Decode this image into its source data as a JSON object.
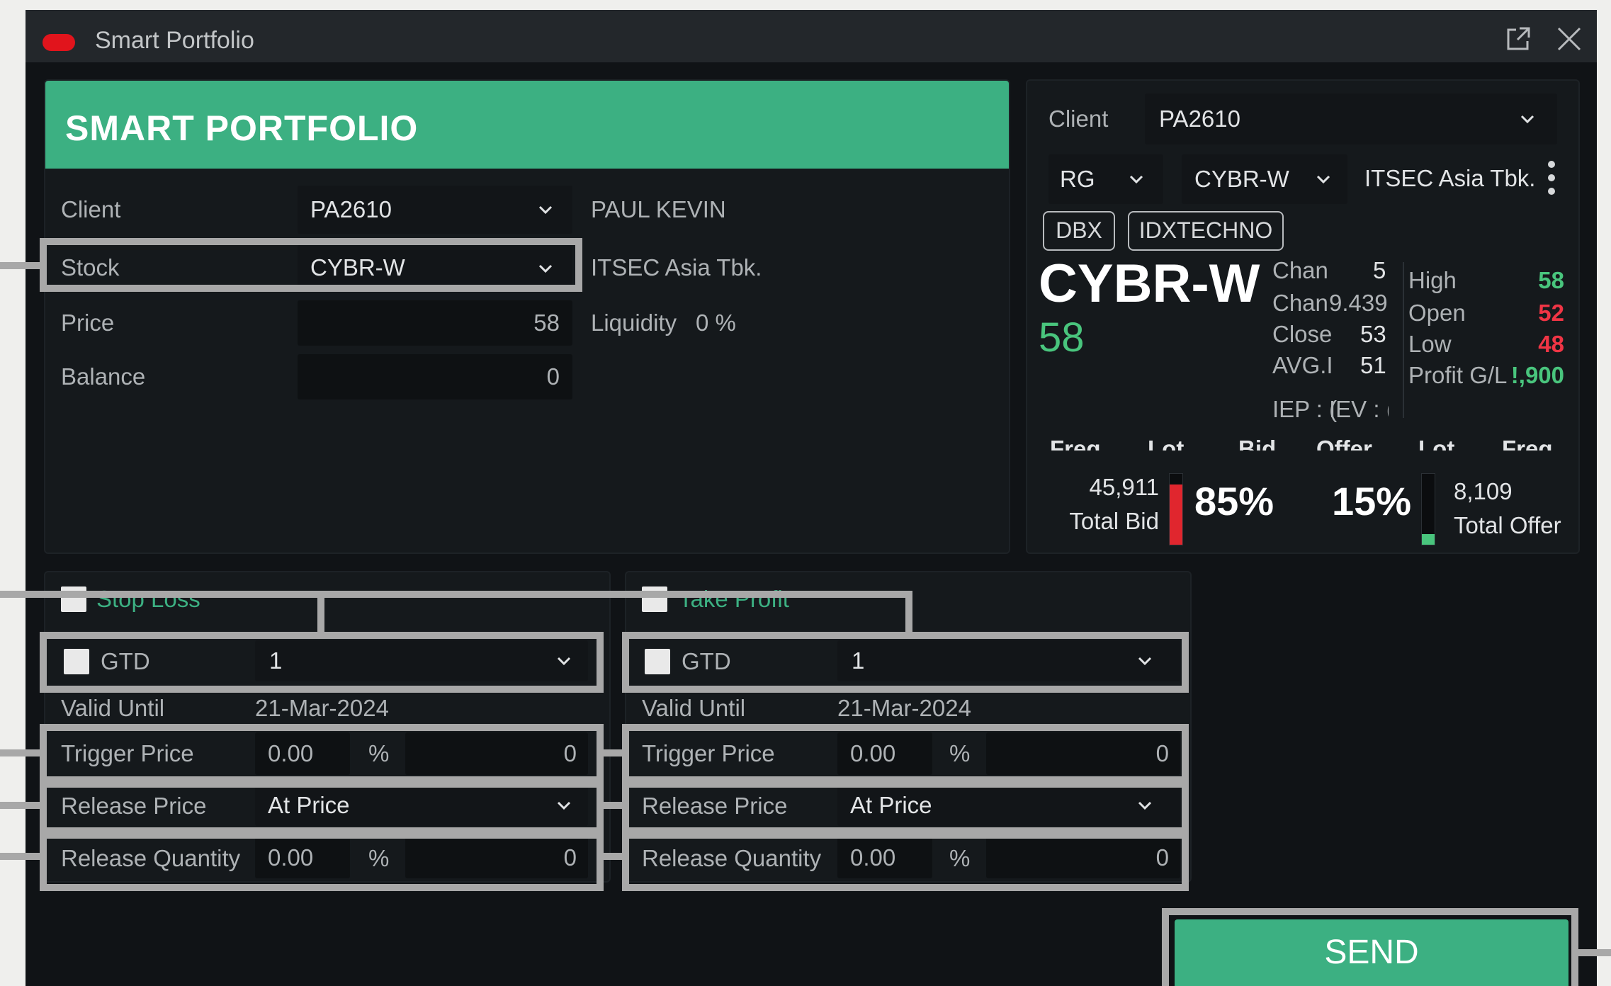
{
  "window": {
    "title": "Smart Portfolio"
  },
  "order": {
    "header": "SMART PORTFOLIO",
    "client_label": "Client",
    "client_value": "PA2610",
    "client_name": "PAUL KEVIN",
    "stock_label": "Stock",
    "stock_value": "CYBR-W",
    "stock_name": "ITSEC Asia Tbk.",
    "price_label": "Price",
    "price_value": "58",
    "liquidity_label": "Liquidity",
    "liquidity_value": "0 %",
    "balance_label": "Balance",
    "balance_value": "0"
  },
  "stop_loss": {
    "title": "Stop Loss",
    "gtd_label": "GTD",
    "gtd_value": "1",
    "valid_until_label": "Valid Until",
    "valid_until_value": "21-Mar-2024",
    "trigger_label": "Trigger Price",
    "trigger_value": "0.00",
    "trigger_unit": "%",
    "trigger_abs": "0",
    "release_price_label": "Release Price",
    "release_price_value": "At Price",
    "release_qty_label": "Release Quantity",
    "release_qty_value": "0.00",
    "release_qty_unit": "%",
    "release_qty_abs": "0"
  },
  "take_profit": {
    "title": "Take Profit",
    "gtd_label": "GTD",
    "gtd_value": "1",
    "valid_until_label": "Valid Until",
    "valid_until_value": "21-Mar-2024",
    "trigger_label": "Trigger Price",
    "trigger_value": "0.00",
    "trigger_unit": "%",
    "trigger_abs": "0",
    "release_price_label": "Release Price",
    "release_price_value": "At Price",
    "release_qty_label": "Release Quantity",
    "release_qty_value": "0.00",
    "release_qty_unit": "%",
    "release_qty_abs": "0"
  },
  "quote": {
    "client_label": "Client",
    "client_value": "PA2610",
    "board_value": "RG",
    "stock_value": "CYBR-W",
    "stock_name": "ITSEC Asia Tbk.",
    "badges": [
      "DBX",
      "IDXTECHNO"
    ],
    "code": "CYBR-W",
    "last_price": "58",
    "chan_label": "Chan",
    "chan_value": "5",
    "chan_pct_label": "Chan",
    "chan_pct_value": "9.439",
    "close_label": "Close",
    "close_value": "53",
    "avg_label": "AVG.I",
    "avg_value": "51",
    "iep_text": "IEP : (",
    "iev_text": "IEV : (",
    "high_label": "High",
    "high_value": "58",
    "open_label": "Open",
    "open_value": "52",
    "low_label": "Low",
    "low_value": "48",
    "pl_label": "Profit G/L",
    "pl_value": "!,900",
    "book_headers": [
      "Freq",
      "Lot",
      "Bid",
      "Offer",
      "Lot",
      "Freq"
    ],
    "total_bid_value": "45,911",
    "total_bid_label": "Total Bid",
    "bid_pct": "85%",
    "offer_pct": "15%",
    "total_offer_value": "8,109",
    "total_offer_label": "Total Offer",
    "bid_fraction": 0.85,
    "offer_fraction": 0.15
  },
  "actions": {
    "send_label": "SEND"
  },
  "colors": {
    "accent": "#3cb082",
    "up": "#49c57d",
    "down": "#f03545",
    "bid_bar": "#e0262e",
    "offer_bar": "#49c57d",
    "annotation": "#a8a8a8"
  },
  "icons": [
    "popout-icon",
    "close-icon",
    "chevron-down-icon",
    "more-vertical-icon",
    "window-status-dot-icon"
  ]
}
